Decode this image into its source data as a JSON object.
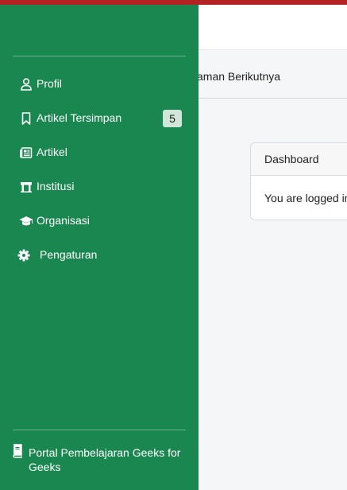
{
  "sidebar": {
    "items": [
      {
        "label": "Profil",
        "icon": "user-icon"
      },
      {
        "label": "Artikel Tersimpan",
        "icon": "bookmark-icon",
        "badge": "5"
      },
      {
        "label": "Artikel",
        "icon": "newspaper-icon"
      },
      {
        "label": "Institusi",
        "icon": "building-icon"
      },
      {
        "label": "Organisasi",
        "icon": "graduation-cap-icon"
      },
      {
        "label": "Pengaturan",
        "icon": "gear-icon"
      }
    ],
    "footer": {
      "label": "Portal Pembelajaran Geeks for Geeks",
      "icon": "book-icon"
    }
  },
  "main": {
    "subnav_text": "aman Berikutnya",
    "card": {
      "title": "Dashboard",
      "body": "You are logged in"
    }
  },
  "colors": {
    "sidebar": "#1a8650",
    "topbar": "#b22222",
    "badge_bg": "#cfe6d8"
  }
}
